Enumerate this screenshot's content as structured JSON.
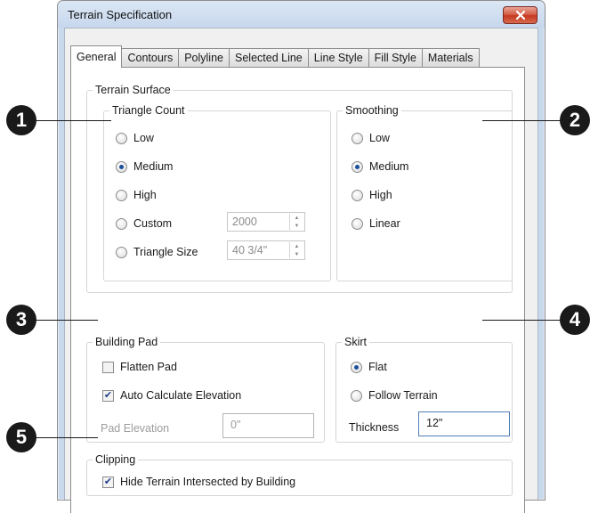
{
  "window": {
    "title": "Terrain Specification"
  },
  "tabs": [
    {
      "label": "General"
    },
    {
      "label": "Contours"
    },
    {
      "label": "Polyline"
    },
    {
      "label": "Selected Line"
    },
    {
      "label": "Line Style"
    },
    {
      "label": "Fill Style"
    },
    {
      "label": "Materials"
    }
  ],
  "terrain_surface": {
    "label": "Terrain Surface",
    "triangle_count": {
      "label": "Triangle Count",
      "options": [
        "Low",
        "Medium",
        "High",
        "Custom",
        "Triangle Size"
      ],
      "selected": "Medium",
      "custom_value": "2000",
      "triangle_size_value": "40 3/4\""
    },
    "smoothing": {
      "label": "Smoothing",
      "options": [
        "Low",
        "Medium",
        "High",
        "Linear"
      ],
      "selected": "Medium"
    }
  },
  "building_pad": {
    "label": "Building Pad",
    "flatten_pad": "Flatten Pad",
    "flatten_pad_checked": false,
    "auto_calc": "Auto Calculate Elevation",
    "auto_calc_checked": true,
    "pad_elevation_label": "Pad Elevation",
    "pad_elevation_value": "0\""
  },
  "skirt": {
    "label": "Skirt",
    "options": [
      "Flat",
      "Follow Terrain"
    ],
    "selected": "Flat",
    "thickness_label": "Thickness",
    "thickness_value": "12\""
  },
  "clipping": {
    "label": "Clipping",
    "hide_terrain": "Hide Terrain Intersected by Building",
    "hide_terrain_checked": true
  },
  "callouts": [
    "1",
    "2",
    "3",
    "4",
    "5"
  ]
}
